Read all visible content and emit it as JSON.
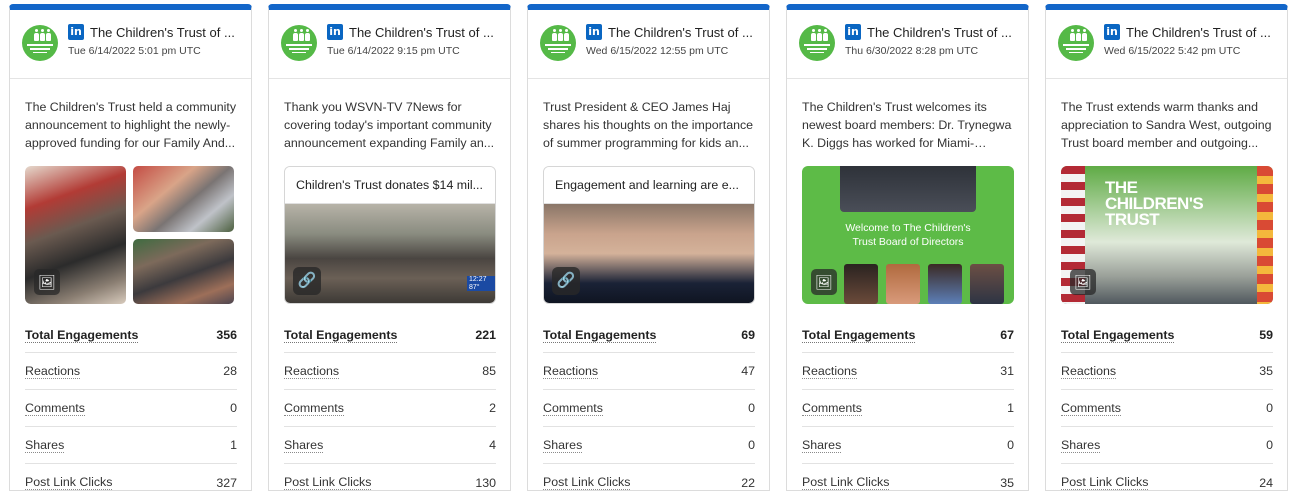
{
  "cards": [
    {
      "author": "The Children's Trust of ...",
      "date": "Tue 6/14/2022 5:01 pm UTC",
      "text": "The Children's Trust held a community announcement to highlight the newly-approved funding for our Family And...",
      "media_type": "photo-grid",
      "media_icon": "image-icon",
      "metrics": [
        {
          "label": "Total Engagements",
          "value": "356"
        },
        {
          "label": "Reactions",
          "value": "28"
        },
        {
          "label": "Comments",
          "value": "0"
        },
        {
          "label": "Shares",
          "value": "1"
        },
        {
          "label": "Post Link Clicks",
          "value": "327"
        }
      ]
    },
    {
      "author": "The Children's Trust of ...",
      "date": "Tue 6/14/2022 9:15 pm UTC",
      "text": "Thank you WSVN-TV 7News for covering today's important community announcement expanding Family an...",
      "media_type": "link-preview",
      "link_title": "Children's Trust donates $14 mil...",
      "media_icon": "link-icon",
      "metrics": [
        {
          "label": "Total Engagements",
          "value": "221"
        },
        {
          "label": "Reactions",
          "value": "85"
        },
        {
          "label": "Comments",
          "value": "2"
        },
        {
          "label": "Shares",
          "value": "4"
        },
        {
          "label": "Post Link Clicks",
          "value": "130"
        }
      ]
    },
    {
      "author": "The Children's Trust of ...",
      "date": "Wed 6/15/2022 12:55 pm UTC",
      "text": "Trust President & CEO James Haj shares his thoughts on the importance of summer programming for kids an...",
      "media_type": "link-preview",
      "link_title": "Engagement and learning are e...",
      "media_icon": "link-icon",
      "metrics": [
        {
          "label": "Total Engagements",
          "value": "69"
        },
        {
          "label": "Reactions",
          "value": "47"
        },
        {
          "label": "Comments",
          "value": "0"
        },
        {
          "label": "Shares",
          "value": "0"
        },
        {
          "label": "Post Link Clicks",
          "value": "22"
        }
      ]
    },
    {
      "author": "The Children's Trust of ...",
      "date": "Thu 6/30/2022 8:28 pm UTC",
      "text": "The Children's Trust welcomes its newest board members: Dr. Trynegwa K. Diggs has worked for Miami-Dade...",
      "media_type": "photo",
      "media_caption": "Welcome to The Children's Trust Board of Directors",
      "media_icon": "image-icon",
      "metrics": [
        {
          "label": "Total Engagements",
          "value": "67"
        },
        {
          "label": "Reactions",
          "value": "31"
        },
        {
          "label": "Comments",
          "value": "1"
        },
        {
          "label": "Shares",
          "value": "0"
        },
        {
          "label": "Post Link Clicks",
          "value": "35"
        }
      ]
    },
    {
      "author": "The Children's Trust of ...",
      "date": "Wed 6/15/2022 5:42 pm UTC",
      "text": "The Trust extends warm thanks and appreciation to Sandra West, outgoing Trust board member and outgoing...",
      "media_type": "photo",
      "media_caption": "THE CHILDREN'S TRUST",
      "media_icon": "image-icon",
      "metrics": [
        {
          "label": "Total Engagements",
          "value": "59"
        },
        {
          "label": "Reactions",
          "value": "35"
        },
        {
          "label": "Comments",
          "value": "0"
        },
        {
          "label": "Shares",
          "value": "0"
        },
        {
          "label": "Post Link Clicks",
          "value": "24"
        }
      ]
    }
  ],
  "network_badge": "in",
  "tv_logo": "12:27 87°",
  "colors": {
    "accent_top": "#1366c9",
    "linkedin": "#0a66c2",
    "avatar_green": "#55b947"
  }
}
